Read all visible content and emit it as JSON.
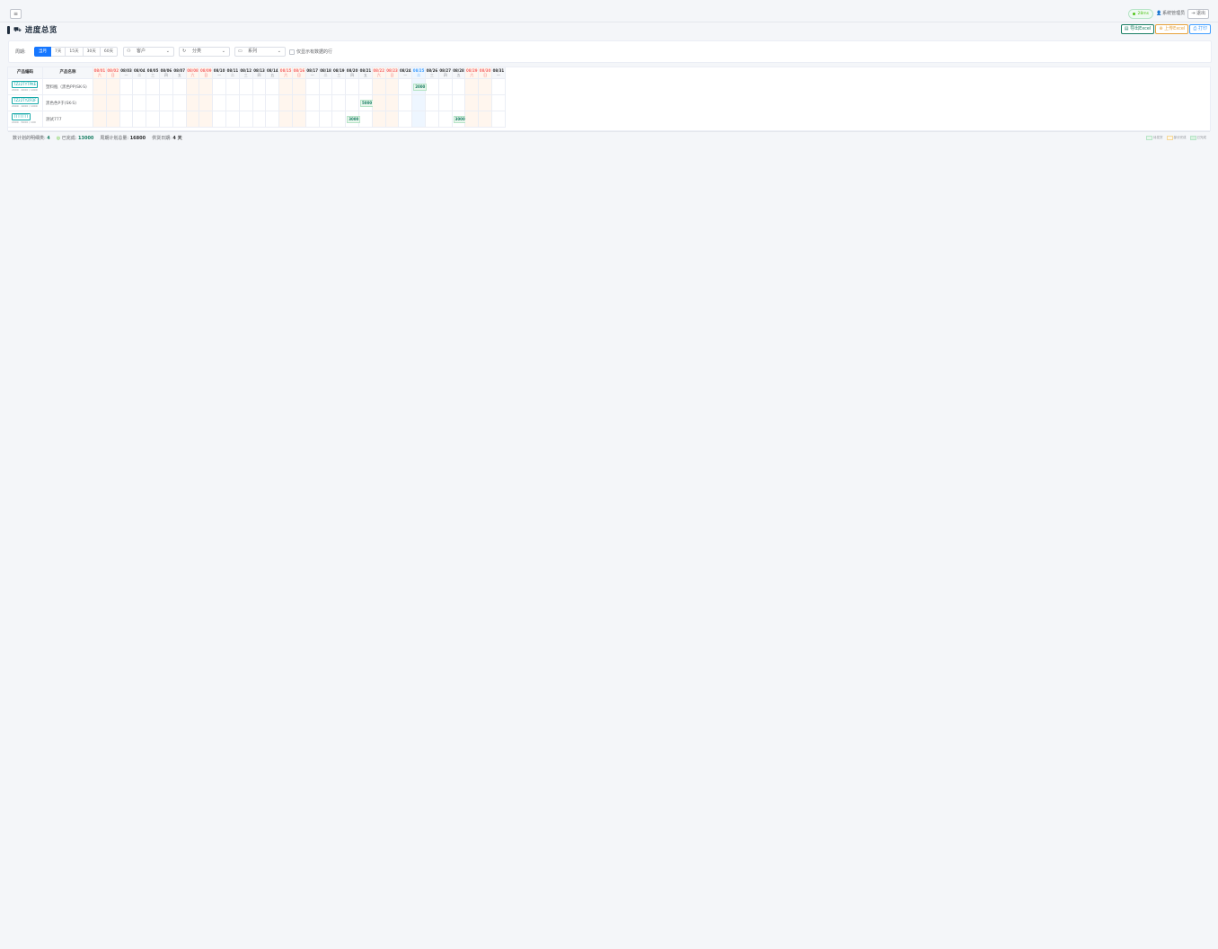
{
  "topbar": {
    "menu_icon": "≡",
    "status_pill": "28ms",
    "user_label": "系统管理员",
    "logout_label": "退出"
  },
  "page": {
    "title": "进度总览"
  },
  "actions": {
    "export_label": "导出Excel",
    "upload_label": "上传Excel",
    "print_label": "打印"
  },
  "filters": {
    "period_label": "周期:",
    "period_options": [
      {
        "label": "当月",
        "active": true
      },
      {
        "label": "7天",
        "active": false
      },
      {
        "label": "15天",
        "active": false
      },
      {
        "label": "30天",
        "active": false
      },
      {
        "label": "60天",
        "active": false
      }
    ],
    "customer_placeholder": "客户",
    "category_placeholder": "分类",
    "series_placeholder": "系列",
    "checkbox_label": "仅显示有数据的行"
  },
  "table": {
    "col_code": "产品编码",
    "col_name": "产品名称",
    "dates": [
      {
        "d": "08/01",
        "w": "六",
        "wk": true
      },
      {
        "d": "08/02",
        "w": "日",
        "wk": true
      },
      {
        "d": "08/03",
        "w": "一"
      },
      {
        "d": "08/04",
        "w": "二"
      },
      {
        "d": "08/05",
        "w": "三"
      },
      {
        "d": "08/06",
        "w": "四"
      },
      {
        "d": "08/07",
        "w": "五"
      },
      {
        "d": "08/08",
        "w": "六",
        "wk": true
      },
      {
        "d": "08/09",
        "w": "日",
        "wk": true
      },
      {
        "d": "08/10",
        "w": "一"
      },
      {
        "d": "08/11",
        "w": "二"
      },
      {
        "d": "08/12",
        "w": "三"
      },
      {
        "d": "08/13",
        "w": "四"
      },
      {
        "d": "08/14",
        "w": "五"
      },
      {
        "d": "08/15",
        "w": "六",
        "wk": true
      },
      {
        "d": "08/16",
        "w": "日",
        "wk": true
      },
      {
        "d": "08/17",
        "w": "一"
      },
      {
        "d": "08/18",
        "w": "二"
      },
      {
        "d": "08/19",
        "w": "三"
      },
      {
        "d": "08/20",
        "w": "四"
      },
      {
        "d": "08/21",
        "w": "五"
      },
      {
        "d": "08/22",
        "w": "六",
        "wk": true
      },
      {
        "d": "08/23",
        "w": "日",
        "wk": true
      },
      {
        "d": "08/24",
        "w": "一"
      },
      {
        "d": "08/25",
        "w": "二",
        "today": true
      },
      {
        "d": "08/26",
        "w": "三"
      },
      {
        "d": "08/27",
        "w": "四"
      },
      {
        "d": "08/28",
        "w": "五"
      },
      {
        "d": "08/29",
        "w": "六",
        "wk": true
      },
      {
        "d": "08/30",
        "w": "日",
        "wk": true
      },
      {
        "d": "08/31",
        "w": "一"
      }
    ],
    "rows": [
      {
        "code": "TZ22TYTPKE",
        "sub": "2000 · 2000 / 1000",
        "name": "塑料瓶（黑色PP)SK-S)",
        "cells": [
          {
            "col": 24,
            "qty": "2000"
          }
        ]
      },
      {
        "code": "TZ22TYZFDF",
        "sub": "2000 · 1000 / 1000",
        "name": "黑色色P于)SK-S)",
        "cells": [
          {
            "col": 20,
            "qty": "5000"
          }
        ]
      },
      {
        "code": "TTTTTTT",
        "sub": "2000 · 5000 / 100",
        "name": "测试777",
        "cells": [
          {
            "col": 19,
            "qty": "3000"
          },
          {
            "col": 27,
            "qty": "3000"
          }
        ]
      }
    ]
  },
  "status": {
    "total_label": "数计划的明细类:",
    "total_value": "4",
    "done_label": "已完成:",
    "done_value": "13000",
    "plan_label": "周期计划总量:",
    "plan_value": "16800",
    "delivery_label": "供货日期:",
    "delivery_value": "4 天",
    "legend": [
      {
        "label": "待发货",
        "color": "#b7e4c7",
        "bg": "#e8f6ec"
      },
      {
        "label": "部分完成",
        "color": "#f5d89a",
        "bg": "#fff7e6"
      },
      {
        "label": "已完成",
        "color": "#b7e4c7",
        "bg": "#d9f2e0"
      }
    ]
  }
}
